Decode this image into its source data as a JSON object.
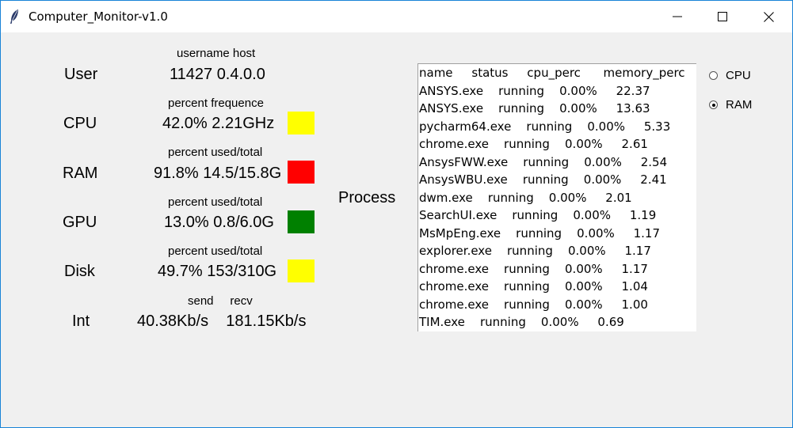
{
  "window": {
    "title": "Computer_Monitor-v1.0"
  },
  "rows": [
    {
      "name": "User",
      "header": "username  host",
      "value": "11427  0.4.0.0"
    },
    {
      "name": "CPU",
      "header": "percent  frequence",
      "value": "42.0%  2.21GHz",
      "status_color": "#ffff00"
    },
    {
      "name": "RAM",
      "header": "percent  used/total",
      "value": "91.8%  14.5/15.8G",
      "status_color": "#ff0000"
    },
    {
      "name": "GPU",
      "header": "percent  used/total",
      "value": "13.0%  0.8/6.0G",
      "status_color": "#008000"
    },
    {
      "name": "Disk",
      "header": "percent  used/total",
      "value": "49.7%  153/310G",
      "status_color": "#ffff00"
    },
    {
      "name": "Int",
      "header": "send     recv",
      "value": "40.38Kb/s    181.15Kb/s"
    }
  ],
  "process": {
    "label": "Process",
    "items": [
      "name     status     cpu_perc      memory_perc",
      "ANSYS.exe    running    0.00%     22.37",
      "ANSYS.exe    running    0.00%     13.63",
      "pycharm64.exe    running    0.00%     5.33",
      "chrome.exe    running    0.00%     2.61",
      "AnsysFWW.exe    running    0.00%     2.54",
      "AnsysWBU.exe    running    0.00%     2.41",
      "dwm.exe    running    0.00%     2.01",
      "SearchUI.exe    running    0.00%     1.19",
      "MsMpEng.exe    running    0.00%     1.17",
      "explorer.exe    running    0.00%     1.17",
      "chrome.exe    running    0.00%     1.17",
      "chrome.exe    running    0.00%     1.04",
      "chrome.exe    running    0.00%     1.00",
      "TIM.exe    running    0.00%     0.69"
    ]
  },
  "sort": {
    "options": [
      "CPU",
      "RAM"
    ],
    "selected": "RAM"
  }
}
